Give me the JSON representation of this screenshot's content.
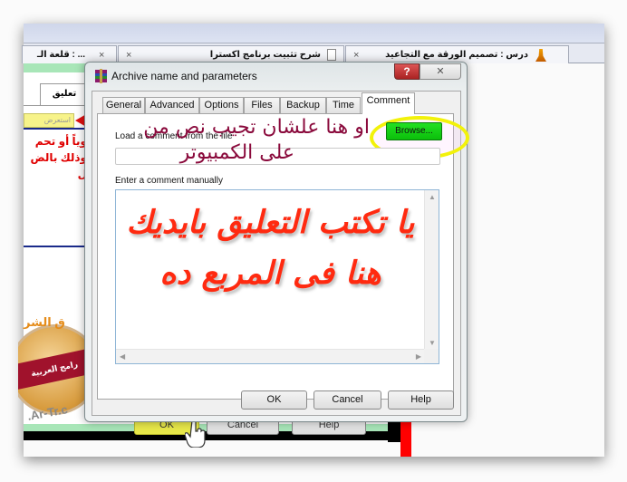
{
  "browser": {
    "tabs": [
      {
        "title": "درس : تصميم الورقة مع التجاعيد",
        "icon": "game-icon"
      },
      {
        "title": "شرح تثبيت برنامج اكسترا",
        "icon": "document-icon"
      },
      {
        "title": "... : قلعة الـ",
        "icon": null
      }
    ],
    "tab_close_glyph": "×"
  },
  "background_page": {
    "tab_label": "تعليق",
    "yellow_button": "استعرض",
    "red_text_lines": [
      "وياً أو تحم",
      "وذلك بالض",
      "ل"
    ],
    "logo_top": "ق الشر",
    "logo_band": "رامج العربية",
    "logo_bottom": ".Ar-Tr.c",
    "buttons": [
      "OK",
      "Cancel",
      "Help"
    ]
  },
  "dialog": {
    "title": "Archive name and parameters",
    "help_glyph": "?",
    "close_glyph": "✕",
    "tabs": [
      "General",
      "Advanced",
      "Options",
      "Files",
      "Backup",
      "Time",
      "Comment"
    ],
    "active_tab": "Comment",
    "load_label": "Load a comment from the file",
    "load_value": "",
    "browse_label": "Browse...",
    "manual_label": "Enter a comment manually",
    "comment_value": "يا تكتب التعليق بايديك هنا فى المربع ده",
    "buttons": {
      "ok": "OK",
      "cancel": "Cancel",
      "help": "Help"
    }
  },
  "annotations": {
    "browse_note_line1": "او هنا علشان تجيب نص من",
    "browse_note_line2": "على الكمبيوتر",
    "highlight_color": "#f2f20a",
    "note_color": "#8a0a3c",
    "comment_color": "#ff2a10"
  },
  "colors": {
    "browse_button": "#1bd41b",
    "help_button": "#c03333"
  }
}
